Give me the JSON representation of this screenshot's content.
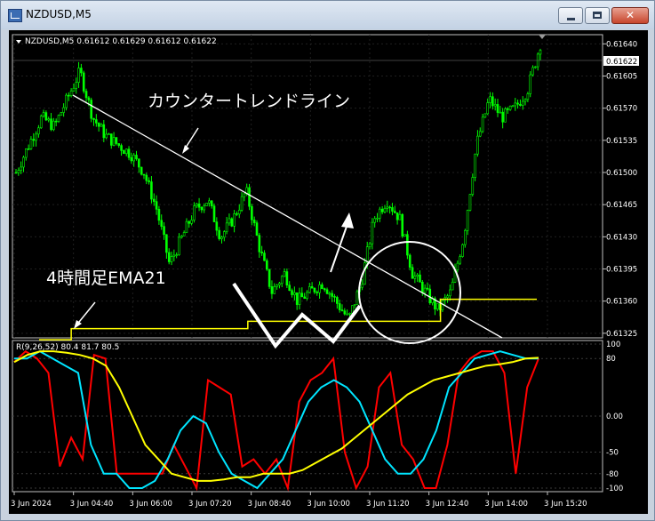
{
  "window": {
    "title": "NZDUSD,M5",
    "min_icon": "minimize-icon",
    "max_icon": "maximize-icon",
    "close_icon": "close-icon",
    "close_glyph": "✕"
  },
  "chart": {
    "symbol_line": "NZDUSD,M5  0.61612 0.61629 0.61612 0.61622",
    "current_price": "0.61622",
    "price_labels": [
      "0.61640",
      "0.61605",
      "0.61570",
      "0.61535",
      "0.61500",
      "0.61465",
      "0.61430",
      "0.61395",
      "0.61360",
      "0.61325"
    ],
    "time_labels": [
      "3 Jun 2024",
      "3 Jun 04:40",
      "3 Jun 06:00",
      "3 Jun 07:20",
      "3 Jun 08:40",
      "3 Jun 10:00",
      "3 Jun 11:20",
      "3 Jun 12:40",
      "3 Jun 14:00",
      "3 Jun 15:20"
    ],
    "annotations": {
      "trendline": "カウンタートレンドライン",
      "ema": "4時間足EMA21"
    },
    "colors": {
      "background": "#000000",
      "candle": "#00ff00",
      "ema": "#ffff00",
      "annotation": "#ffffff"
    }
  },
  "indicator": {
    "label": "R(9,26,52) 80.4 81.7 80.5",
    "levels": [
      "100",
      "80",
      "0.00",
      "-50",
      "-80",
      "-100"
    ],
    "colors": {
      "fast": "#ff0000",
      "mid": "#00e5ff",
      "slow": "#ffff00"
    }
  },
  "chart_data": {
    "type": "line",
    "title": "",
    "x_ticks": [
      "3 Jun 2024",
      "3 Jun 04:40",
      "3 Jun 06:00",
      "3 Jun 07:20",
      "3 Jun 08:40",
      "3 Jun 10:00",
      "3 Jun 11:20",
      "3 Jun 12:40",
      "3 Jun 14:00",
      "3 Jun 15:20"
    ],
    "price_ylim": [
      0.6132,
      0.6165
    ],
    "price_series": [
      {
        "values": [
          0.615,
          0.6153,
          0.6156,
          0.6155,
          0.6158,
          0.6161,
          0.6156,
          0.6154,
          0.6153,
          0.6152,
          0.615,
          0.6146,
          0.614,
          0.6143,
          0.6146,
          0.6147,
          0.6143,
          0.6145,
          0.6148,
          0.6142,
          0.6137,
          0.6139,
          0.6136,
          0.6137,
          0.6138,
          0.6136,
          0.6134,
          0.6138,
          0.6145,
          0.6147,
          0.6145,
          0.6139,
          0.6137,
          0.6135,
          0.6137,
          0.6143,
          0.6153,
          0.6158,
          0.6156,
          0.6157,
          0.6159,
          0.6164
        ]
      },
      {
        "values": [
          0.61318,
          0.61318,
          0.6133,
          0.6133,
          0.6133,
          0.6133,
          0.6133,
          0.6133,
          0.6133,
          0.6133,
          0.6133,
          0.6133,
          0.6133,
          0.61338,
          0.61338,
          0.61338,
          0.61338,
          0.61338,
          0.61338,
          0.61338,
          0.61338,
          0.61338,
          0.61338,
          0.61338,
          0.61338,
          0.61362,
          0.61362,
          0.61362,
          0.61362,
          0.61362,
          0.61362,
          0.61362
        ]
      }
    ],
    "indicator_ylim": [
      -105,
      105
    ],
    "indicator_series": [
      {
        "values": [
          75,
          90,
          80,
          60,
          -70,
          -30,
          -60,
          85,
          80,
          -80,
          -80,
          -80,
          -80,
          -80,
          -40,
          -70,
          -100,
          50,
          40,
          30,
          -70,
          -60,
          -80,
          -60,
          -100,
          20,
          50,
          60,
          80,
          -50,
          -100,
          -70,
          40,
          60,
          -40,
          -60,
          -100,
          -100,
          -40,
          60,
          80,
          90,
          90,
          60,
          -80,
          40,
          80
        ]
      },
      {
        "values": [
          80,
          80,
          90,
          80,
          70,
          60,
          -40,
          -80,
          -80,
          -100,
          -100,
          -90,
          -60,
          -20,
          0,
          -10,
          -50,
          -80,
          -90,
          -100,
          -80,
          -60,
          -20,
          20,
          40,
          50,
          40,
          20,
          -20,
          -60,
          -80,
          -80,
          -60,
          -20,
          40,
          60,
          80,
          85,
          90,
          85,
          80,
          80
        ]
      },
      {
        "values": [
          75,
          85,
          90,
          90,
          88,
          85,
          80,
          70,
          40,
          0,
          -40,
          -60,
          -80,
          -85,
          -90,
          -90,
          -88,
          -85,
          -85,
          -80,
          -80,
          -80,
          -75,
          -65,
          -55,
          -45,
          -30,
          -15,
          0,
          15,
          30,
          40,
          50,
          55,
          60,
          65,
          70,
          72,
          75,
          80,
          81
        ]
      }
    ]
  }
}
